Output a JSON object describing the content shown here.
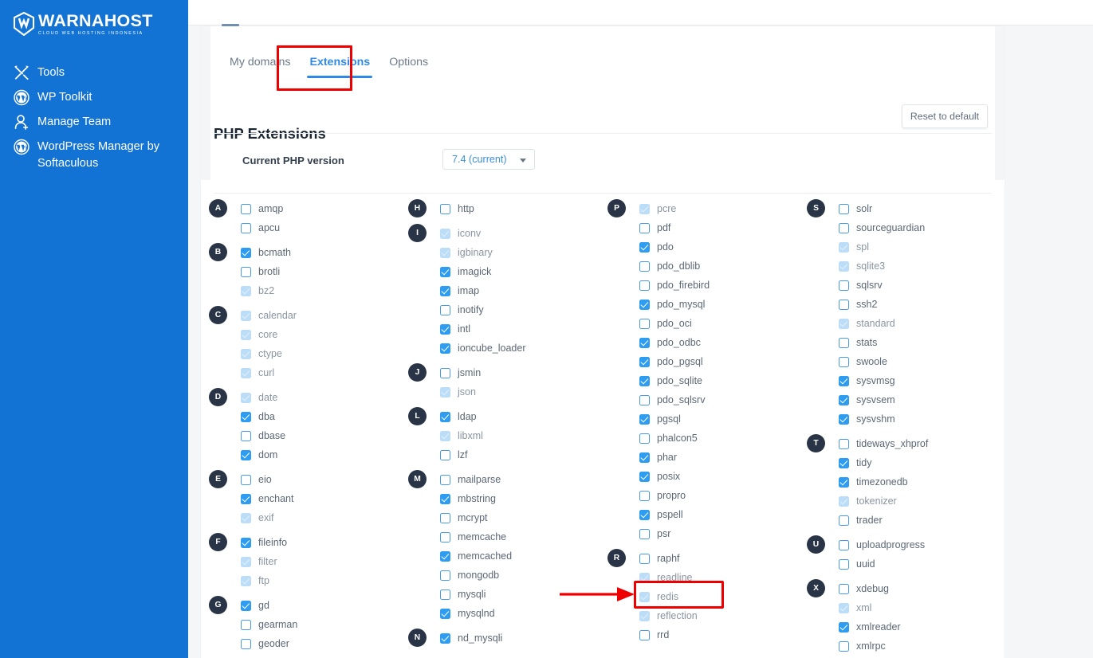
{
  "sidebar": {
    "brand_name": "WARNAHOST",
    "brand_tagline": "CLOUD WEB HOSTING INDONESIA",
    "items": [
      {
        "label": "Tools",
        "icon": "tools-icon"
      },
      {
        "label": "WP Toolkit",
        "icon": "wordpress-icon"
      },
      {
        "label": "Manage Team",
        "icon": "manage-team-icon"
      },
      {
        "label": "WordPress Manager by Softaculous",
        "icon": "wordpress-icon"
      }
    ]
  },
  "tabs": [
    {
      "label": "My domains",
      "active": false
    },
    {
      "label": "Extensions",
      "active": true
    },
    {
      "label": "Options",
      "active": false
    }
  ],
  "page": {
    "title": "PHP Extensions",
    "reset_label": "Reset to default",
    "version_label": "Current PHP version",
    "version_value": "7.4 (current)"
  },
  "colors": {
    "sidebar_bg": "#1273d4",
    "accent": "#2e8ae6",
    "checkbox_on": "#2e9cf0",
    "checkbox_locked": "#bcddf8",
    "badge_bg": "#293447",
    "highlight": "#ee0000"
  },
  "columns": [
    {
      "groups": [
        {
          "letter": "A",
          "items": [
            {
              "name": "amqp",
              "state": "off"
            },
            {
              "name": "apcu",
              "state": "off"
            }
          ]
        },
        {
          "letter": "B",
          "items": [
            {
              "name": "bcmath",
              "state": "on"
            },
            {
              "name": "brotli",
              "state": "off"
            },
            {
              "name": "bz2",
              "state": "locked"
            }
          ]
        },
        {
          "letter": "C",
          "items": [
            {
              "name": "calendar",
              "state": "locked"
            },
            {
              "name": "core",
              "state": "locked"
            },
            {
              "name": "ctype",
              "state": "locked"
            },
            {
              "name": "curl",
              "state": "locked"
            }
          ]
        },
        {
          "letter": "D",
          "items": [
            {
              "name": "date",
              "state": "locked"
            },
            {
              "name": "dba",
              "state": "on"
            },
            {
              "name": "dbase",
              "state": "off"
            },
            {
              "name": "dom",
              "state": "on"
            }
          ]
        },
        {
          "letter": "E",
          "items": [
            {
              "name": "eio",
              "state": "off"
            },
            {
              "name": "enchant",
              "state": "on"
            },
            {
              "name": "exif",
              "state": "locked"
            }
          ]
        },
        {
          "letter": "F",
          "items": [
            {
              "name": "fileinfo",
              "state": "on"
            },
            {
              "name": "filter",
              "state": "locked"
            },
            {
              "name": "ftp",
              "state": "locked"
            }
          ]
        },
        {
          "letter": "G",
          "items": [
            {
              "name": "gd",
              "state": "on"
            },
            {
              "name": "gearman",
              "state": "off"
            },
            {
              "name": "geoder",
              "state": "off"
            }
          ]
        }
      ]
    },
    {
      "groups": [
        {
          "letter": "H",
          "items": [
            {
              "name": "http",
              "state": "off"
            }
          ]
        },
        {
          "letter": "I",
          "items": [
            {
              "name": "iconv",
              "state": "locked"
            },
            {
              "name": "igbinary",
              "state": "locked"
            },
            {
              "name": "imagick",
              "state": "on"
            },
            {
              "name": "imap",
              "state": "on"
            },
            {
              "name": "inotify",
              "state": "off"
            },
            {
              "name": "intl",
              "state": "on"
            },
            {
              "name": "ioncube_loader",
              "state": "on"
            }
          ]
        },
        {
          "letter": "J",
          "items": [
            {
              "name": "jsmin",
              "state": "off"
            },
            {
              "name": "json",
              "state": "locked"
            }
          ]
        },
        {
          "letter": "L",
          "items": [
            {
              "name": "ldap",
              "state": "on"
            },
            {
              "name": "libxml",
              "state": "locked"
            },
            {
              "name": "lzf",
              "state": "off"
            }
          ]
        },
        {
          "letter": "M",
          "items": [
            {
              "name": "mailparse",
              "state": "off"
            },
            {
              "name": "mbstring",
              "state": "on"
            },
            {
              "name": "mcrypt",
              "state": "off"
            },
            {
              "name": "memcache",
              "state": "off"
            },
            {
              "name": "memcached",
              "state": "on"
            },
            {
              "name": "mongodb",
              "state": "off"
            },
            {
              "name": "mysqli",
              "state": "off"
            },
            {
              "name": "mysqlnd",
              "state": "on"
            }
          ]
        },
        {
          "letter": "N",
          "items": [
            {
              "name": "nd_mysqli",
              "state": "on"
            }
          ]
        }
      ]
    },
    {
      "groups": [
        {
          "letter": "P",
          "items": [
            {
              "name": "pcre",
              "state": "locked"
            },
            {
              "name": "pdf",
              "state": "off"
            },
            {
              "name": "pdo",
              "state": "on"
            },
            {
              "name": "pdo_dblib",
              "state": "off"
            },
            {
              "name": "pdo_firebird",
              "state": "off"
            },
            {
              "name": "pdo_mysql",
              "state": "on"
            },
            {
              "name": "pdo_oci",
              "state": "off"
            },
            {
              "name": "pdo_odbc",
              "state": "on"
            },
            {
              "name": "pdo_pgsql",
              "state": "on"
            },
            {
              "name": "pdo_sqlite",
              "state": "on"
            },
            {
              "name": "pdo_sqlsrv",
              "state": "off"
            },
            {
              "name": "pgsql",
              "state": "on"
            },
            {
              "name": "phalcon5",
              "state": "off"
            },
            {
              "name": "phar",
              "state": "on"
            },
            {
              "name": "posix",
              "state": "on"
            },
            {
              "name": "propro",
              "state": "off"
            },
            {
              "name": "pspell",
              "state": "on"
            },
            {
              "name": "psr",
              "state": "off"
            }
          ]
        },
        {
          "letter": "R",
          "items": [
            {
              "name": "raphf",
              "state": "off"
            },
            {
              "name": "readline",
              "state": "locked"
            },
            {
              "name": "redis",
              "state": "locked"
            },
            {
              "name": "reflection",
              "state": "locked"
            },
            {
              "name": "rrd",
              "state": "off"
            }
          ]
        }
      ]
    },
    {
      "groups": [
        {
          "letter": "S",
          "items": [
            {
              "name": "solr",
              "state": "off"
            },
            {
              "name": "sourceguardian",
              "state": "off"
            },
            {
              "name": "spl",
              "state": "locked"
            },
            {
              "name": "sqlite3",
              "state": "locked"
            },
            {
              "name": "sqlsrv",
              "state": "off"
            },
            {
              "name": "ssh2",
              "state": "off"
            },
            {
              "name": "standard",
              "state": "locked"
            },
            {
              "name": "stats",
              "state": "off"
            },
            {
              "name": "swoole",
              "state": "off"
            },
            {
              "name": "sysvmsg",
              "state": "on"
            },
            {
              "name": "sysvsem",
              "state": "on"
            },
            {
              "name": "sysvshm",
              "state": "on"
            }
          ]
        },
        {
          "letter": "T",
          "items": [
            {
              "name": "tideways_xhprof",
              "state": "off"
            },
            {
              "name": "tidy",
              "state": "on"
            },
            {
              "name": "timezonedb",
              "state": "on"
            },
            {
              "name": "tokenizer",
              "state": "locked"
            },
            {
              "name": "trader",
              "state": "off"
            }
          ]
        },
        {
          "letter": "U",
          "items": [
            {
              "name": "uploadprogress",
              "state": "off"
            },
            {
              "name": "uuid",
              "state": "off"
            }
          ]
        },
        {
          "letter": "X",
          "items": [
            {
              "name": "xdebug",
              "state": "off"
            },
            {
              "name": "xml",
              "state": "locked"
            },
            {
              "name": "xmlreader",
              "state": "on"
            },
            {
              "name": "xmlrpc",
              "state": "off"
            }
          ]
        }
      ]
    }
  ]
}
